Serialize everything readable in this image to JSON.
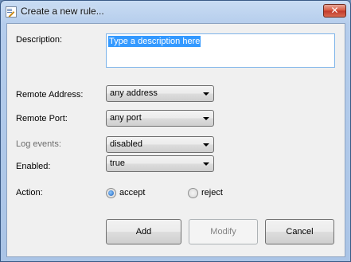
{
  "window": {
    "title": "Create a new rule...",
    "close_label": "✕"
  },
  "form": {
    "description_label": "Description:",
    "description_value": "Type a description here",
    "remote_address_label": "Remote Address:",
    "remote_address_value": "any address",
    "remote_port_label": "Remote Port:",
    "remote_port_value": "any port",
    "log_events_label": "Log events:",
    "log_events_value": "disabled",
    "enabled_label": "Enabled:",
    "enabled_value": "true",
    "action_label": "Action:",
    "action_options": [
      {
        "label": "accept",
        "checked": true
      },
      {
        "label": "reject",
        "checked": false
      }
    ]
  },
  "buttons": {
    "add": "Add",
    "modify": "Modify",
    "cancel": "Cancel"
  }
}
